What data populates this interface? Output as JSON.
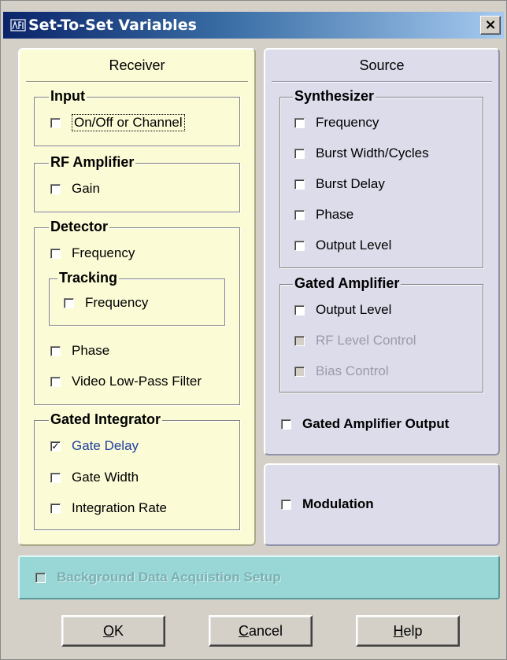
{
  "window": {
    "title": "Set-To-Set Variables",
    "close_label": "×"
  },
  "receiver": {
    "title": "Receiver",
    "input": {
      "label": "Input",
      "items": [
        {
          "label": "On/Off or Channel",
          "checked": false
        }
      ]
    },
    "rf_amplifier": {
      "label": "RF Amplifier",
      "items": [
        {
          "label": "Gain",
          "checked": false
        }
      ]
    },
    "detector": {
      "label": "Detector",
      "frequency": "Frequency",
      "tracking": {
        "label": "Tracking",
        "frequency": "Frequency"
      },
      "phase": "Phase",
      "video_filter": "Video Low-Pass Filter"
    },
    "gated_integrator": {
      "label": "Gated Integrator",
      "gate_delay": "Gate Delay",
      "gate_delay_checked": "✓",
      "gate_width": "Gate Width",
      "integration_rate": "Integration Rate"
    }
  },
  "source": {
    "title": "Source",
    "synthesizer": {
      "label": "Synthesizer",
      "frequency": "Frequency",
      "burst_width": "Burst Width/Cycles",
      "burst_delay": "Burst Delay",
      "phase": "Phase",
      "output_level": "Output Level"
    },
    "gated_amplifier": {
      "label": "Gated Amplifier",
      "output_level": "Output Level",
      "rf_level_control": "RF Level Control",
      "bias_control": "Bias Control"
    },
    "gated_amplifier_output": "Gated Amplifier Output"
  },
  "modulation": {
    "label": "Modulation"
  },
  "background": {
    "label": "Background Data Acquistion Setup"
  },
  "buttons": {
    "ok_ul": "O",
    "ok_rest": "K",
    "cancel_ul": "C",
    "cancel_rest": "ancel",
    "help_ul": "H",
    "help_rest": "elp"
  },
  "colors": {
    "receiver_bg": "#fbfbd6",
    "source_bg": "#dcdceb",
    "background_panel_bg": "#99d6d6",
    "titlebar_start": "#0a246a",
    "titlebar_end": "#a6caf0",
    "checked_label": "#2040a0"
  }
}
